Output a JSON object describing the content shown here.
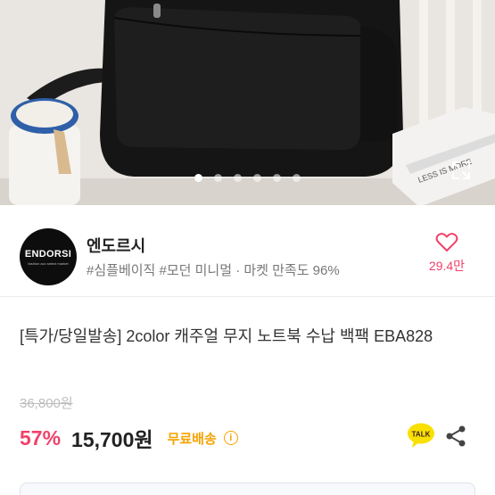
{
  "hero": {
    "slide_count": 6,
    "active_slide": 1,
    "book_text": "LESS IS MORE"
  },
  "store": {
    "logo_text": "ENDORSI",
    "logo_subtext": "fashion acc select market",
    "name": "엔도르시",
    "tags": "#심플베이직 #모던 미니멀 · 마켓 만족도 96%",
    "likes": "29.4만"
  },
  "product": {
    "title": "[특가/당일발송] 2color 캐주얼 무지 노트북 수납 백팩 EBA828",
    "original_price": "36,800원",
    "discount": "57%",
    "price": "15,700원",
    "shipping": "무료배송",
    "talk_label": "TALK"
  },
  "colors": {
    "accent_pink": "#f1416a",
    "shipping_orange": "#f5a300",
    "talk_yellow": "#f9e000"
  }
}
